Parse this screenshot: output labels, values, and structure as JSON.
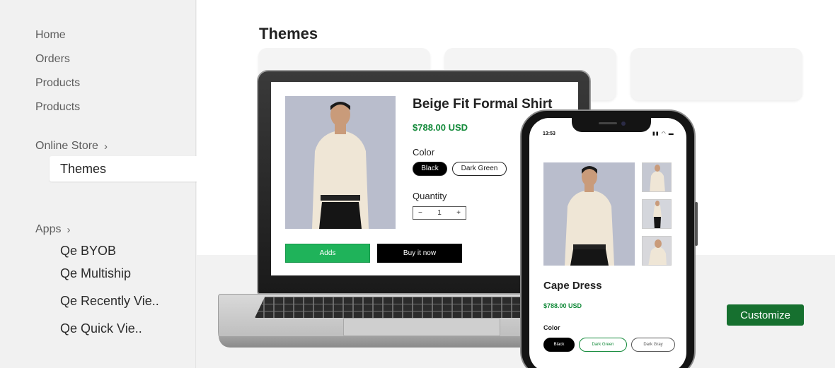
{
  "sidebar": {
    "items": [
      {
        "label": "Home"
      },
      {
        "label": "Orders"
      },
      {
        "label": "Products"
      },
      {
        "label": "Products"
      }
    ],
    "online_store": {
      "label": "Online Store",
      "chevron": "›",
      "sub": {
        "label": "Themes"
      }
    },
    "apps": {
      "label": "Apps",
      "chevron": "›",
      "sub": [
        {
          "label": "Qe BYOB"
        },
        {
          "label": "Qe Multiship"
        },
        {
          "label": "Qe Recently Vie.."
        },
        {
          "label": "Qe Quick Vie.."
        }
      ]
    }
  },
  "main": {
    "title": "Themes",
    "customize_label": "Customize"
  },
  "laptop_preview": {
    "product_title": "Beige Fit Formal Shirt",
    "price": "$788.00 USD",
    "color_label": "Color",
    "colors": [
      "Black",
      "Dark Green"
    ],
    "quantity_label": "Quantity",
    "quantity": "1",
    "minus": "−",
    "plus": "+",
    "add_label": "Adds",
    "buy_label": "Buy it now"
  },
  "phone_preview": {
    "time": "13:53",
    "status": "▮▮ ◠ ▬",
    "product_title": "Cape Dress",
    "price": "$788.00 USD",
    "color_label": "Color",
    "colors": [
      "Black",
      "Dark Green",
      "Dark Gray"
    ]
  },
  "colors": {
    "accent_green": "#16702f",
    "price_green": "#138a3a",
    "add_green": "#1fb35a"
  }
}
